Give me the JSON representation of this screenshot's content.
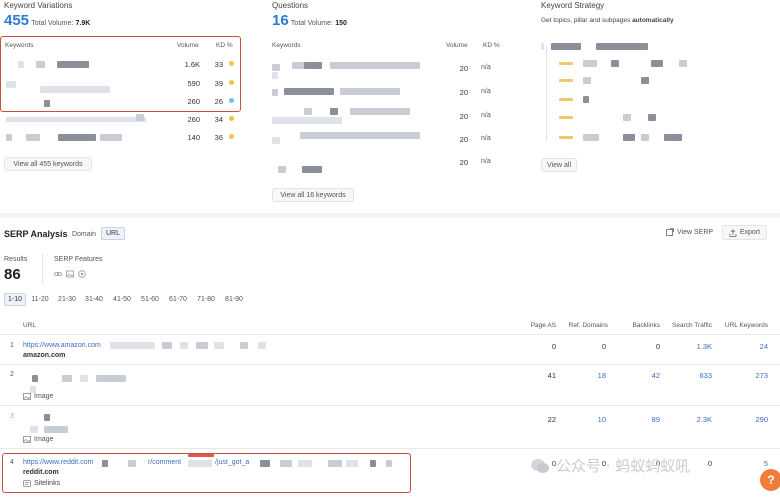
{
  "keyword_variations": {
    "title": "Keyword Variations",
    "count": "455",
    "total_label": "Total Volume:",
    "total_value": "7.9K",
    "col_keywords": "Keywords",
    "col_volume": "Volume",
    "col_kd": "KD %",
    "rows": [
      {
        "volume": "1.6K",
        "kd": "33",
        "kd_color": "#f0c24b"
      },
      {
        "volume": "590",
        "kd": "39",
        "kd_color": "#f0c24b"
      },
      {
        "volume": "260",
        "kd": "26",
        "kd_color": "#6cc6d8"
      },
      {
        "volume": "260",
        "kd": "34",
        "kd_color": "#f0c24b"
      },
      {
        "volume": "140",
        "kd": "36",
        "kd_color": "#f0c24b"
      }
    ],
    "view_all": "View all 455 keywords"
  },
  "questions": {
    "title": "Questions",
    "count": "16",
    "total_label": "Total Volume:",
    "total_value": "150",
    "col_keywords": "Keywords",
    "col_volume": "Volume",
    "col_kd": "KD %",
    "rows": [
      {
        "volume": "20",
        "kd": "n/a"
      },
      {
        "volume": "20",
        "kd": "n/a"
      },
      {
        "volume": "20",
        "kd": "n/a"
      },
      {
        "volume": "20",
        "kd": "n/a"
      },
      {
        "volume": "20",
        "kd": "n/a"
      }
    ],
    "view_all": "View all 16 keywords"
  },
  "keyword_strategy": {
    "title": "Keyword Strategy",
    "subtitle_prefix": "Get topics, pillar and subpages ",
    "subtitle_bold": "automatically",
    "view_all": "View all"
  },
  "serp": {
    "title": "SERP Analysis",
    "toggle_domain": "Domain",
    "toggle_url": "URL",
    "view_serp": "View SERP",
    "export": "Export",
    "results_label": "Results",
    "results_value": "86",
    "features_label": "SERP Features",
    "pages": [
      "1-10",
      "11-20",
      "21-30",
      "31-40",
      "41-50",
      "51-60",
      "61-70",
      "71-80",
      "81-90"
    ],
    "columns": {
      "url": "URL",
      "page_as": "Page AS",
      "ref_domains": "Ref. Domains",
      "backlinks": "Backlinks",
      "search_traffic": "Search Traffic",
      "url_keywords": "URL Keywords"
    },
    "rows": [
      {
        "index": "1",
        "url": "https://www.amazon.com",
        "domain": "amazon.com",
        "page_as": "0",
        "ref_domains": "0",
        "backlinks": "0",
        "traffic": "1.3K",
        "url_keywords": "24"
      },
      {
        "index": "2",
        "feature": "Image",
        "page_as": "41",
        "ref_domains": "18",
        "backlinks": "42",
        "traffic": "633",
        "url_keywords": "273"
      },
      {
        "index": "3",
        "feature": "Image",
        "page_as": "22",
        "ref_domains": "10",
        "backlinks": "89",
        "traffic": "2.3K",
        "url_keywords": "290"
      },
      {
        "index": "4",
        "url": "https://www.reddit.com",
        "url_mid": "r/comment",
        "url_end": "/just_got_a",
        "domain": "reddit.com",
        "feature": "Sitelinks",
        "page_as": "0",
        "ref_domains": "0",
        "backlinks": "0",
        "traffic": "0",
        "url_keywords": "5"
      }
    ]
  },
  "watermark": "公众号 · 蚂蚁蚂蚁吼",
  "help_badge": "?",
  "colors": {
    "accent": "#2b7bd4",
    "highlight": "#c8503c",
    "link": "#3a6fc2"
  }
}
